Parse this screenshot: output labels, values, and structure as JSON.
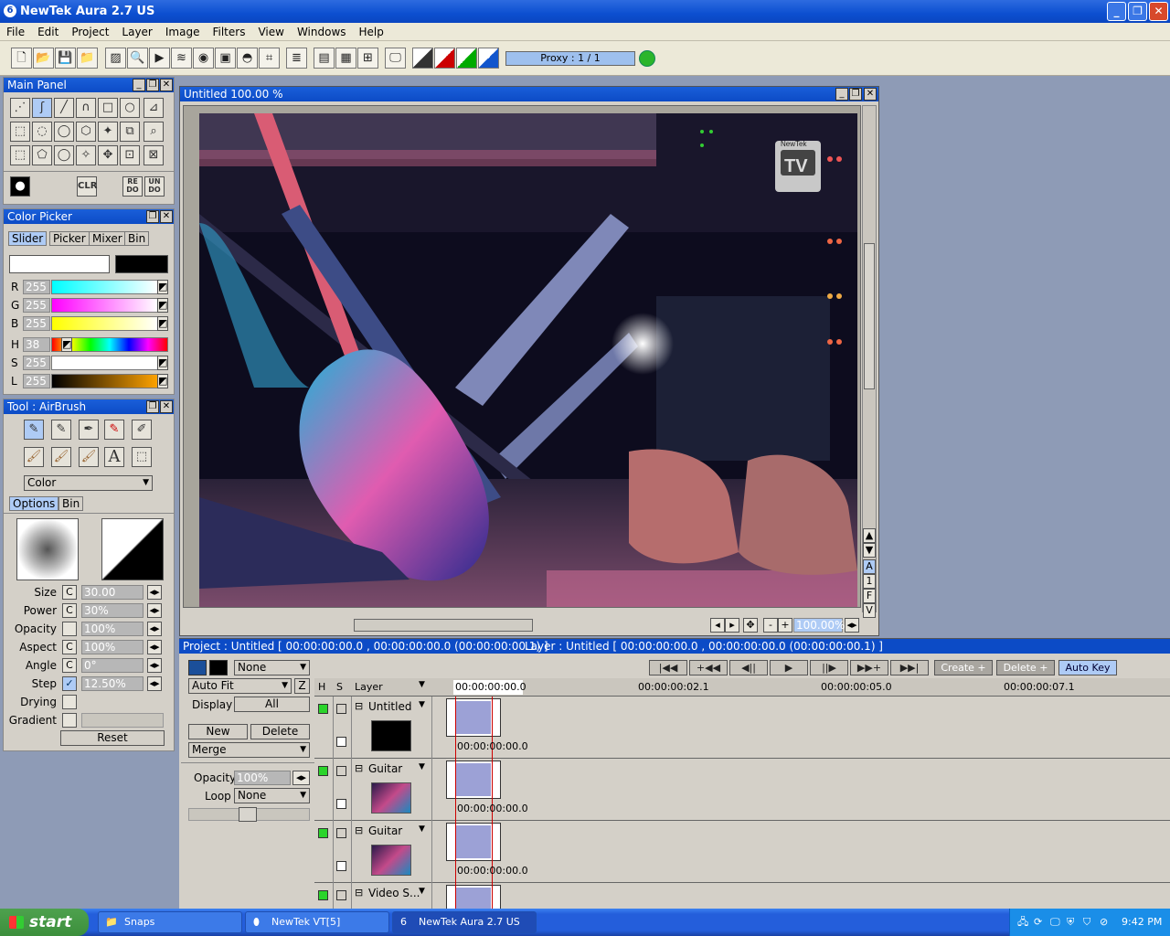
{
  "window": {
    "title": "NewTek Aura 2.7 US"
  },
  "menu": [
    "File",
    "Edit",
    "Project",
    "Layer",
    "Image",
    "Filters",
    "View",
    "Windows",
    "Help"
  ],
  "toolbar": {
    "proxy_label": "Proxy : 1 / 1",
    "status_color": "#2bb52b"
  },
  "main_panel": {
    "title": "Main Panel",
    "clr": "CLR",
    "redo": "RE DO",
    "undo": "UN DO"
  },
  "color_picker": {
    "title": "Color Picker",
    "tabs": [
      "Slider",
      "Picker",
      "Mixer",
      "Bin"
    ],
    "channels": [
      {
        "label": "R",
        "value": "255"
      },
      {
        "label": "G",
        "value": "255"
      },
      {
        "label": "B",
        "value": "255"
      },
      {
        "label": "H",
        "value": "38"
      },
      {
        "label": "S",
        "value": "255"
      },
      {
        "label": "L",
        "value": "255"
      }
    ]
  },
  "tool_panel": {
    "title": "Tool : AirBrush",
    "mode": "Color",
    "tabs": [
      "Options",
      "Bin"
    ],
    "params": [
      {
        "label": "Size",
        "value": "30.00"
      },
      {
        "label": "Power",
        "value": "30%"
      },
      {
        "label": "Opacity",
        "value": "100%"
      },
      {
        "label": "Aspect",
        "value": "100%"
      },
      {
        "label": "Angle",
        "value": "0°"
      },
      {
        "label": "Step",
        "value": "12.50%"
      }
    ],
    "drying": "Drying",
    "gradient": "Gradient",
    "reset": "Reset"
  },
  "canvas": {
    "title": "Untitled 100.00 %",
    "zoom": "100.00%",
    "badge": "NewTek",
    "badge_tv": "TV",
    "side_buttons": [
      "A",
      "1",
      "F",
      "V"
    ]
  },
  "timeline": {
    "project_info": "Project : Untitled [ 00:00:00:00.0 , 00:00:00:00.0  (00:00:00:00.1) ]",
    "layer_info": "Layer : Untitled [ 00:00:00:00.0 , 00:00:00:00.0  (00:00:00:00.1) ]",
    "none_label": "None",
    "autofit": "Auto Fit",
    "z": "Z",
    "display": "Display",
    "all": "All",
    "new": "New",
    "delete": "Delete",
    "merge": "Merge",
    "opacity_label": "Opacity",
    "opacity_value": "100%",
    "loop_label": "Loop",
    "loop_value": "None",
    "transport": [
      "|◀◀",
      "+◀◀",
      "◀||",
      "▶",
      "||▶",
      "▶▶+",
      "▶▶|"
    ],
    "create": "Create +",
    "delete_key": "Delete +",
    "auto_key": "Auto Key",
    "col_h": "H",
    "col_s": "S",
    "col_layer": "Layer",
    "ruler": [
      "00:00:00:00.0",
      "00:00:00:02.1",
      "00:00:00:05.0",
      "00:00:00:07.1"
    ],
    "tracks": [
      {
        "name": "Untitled",
        "time": "00:00:00:00.0"
      },
      {
        "name": "Guitar",
        "time": "00:00:00:00.0"
      },
      {
        "name": "Guitar",
        "time": "00:00:00:00.0"
      },
      {
        "name": "Video S...",
        "time": ""
      }
    ]
  },
  "taskbar": {
    "start": "start",
    "tasks": [
      "Snaps",
      "NewTek VT[5]",
      "NewTek Aura 2.7 US"
    ],
    "clock": "9:42 PM"
  }
}
